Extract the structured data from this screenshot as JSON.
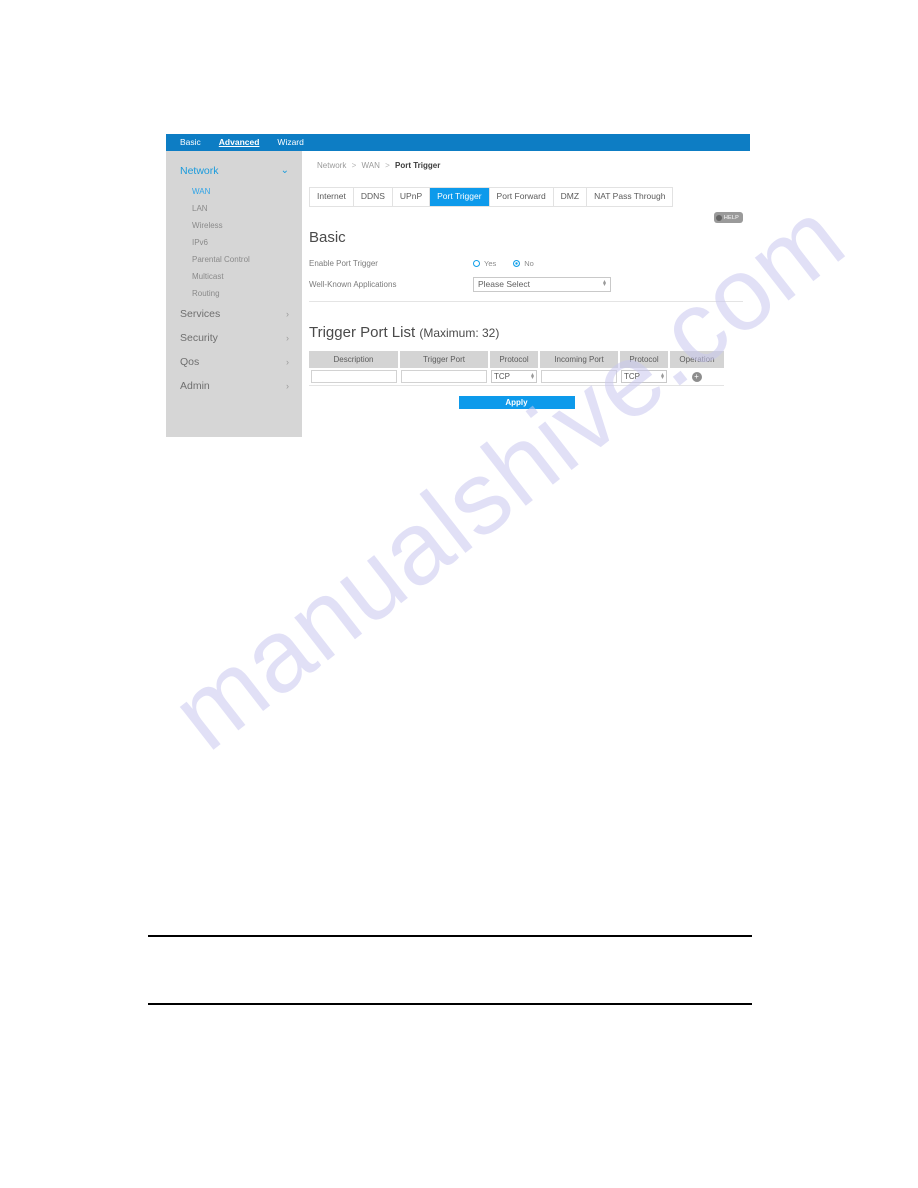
{
  "watermark": {
    "text": "manualshive.com"
  },
  "colors": {
    "topnav_blue": "#0d7dc4",
    "accent_blue": "#0d9aeb",
    "sidebar_gray": "#d6d6d6",
    "table_header_gray": "#d4d4d4",
    "watermark_lavender": "#c9c8ef"
  },
  "topnav": {
    "items": [
      {
        "label": "Basic",
        "active": false
      },
      {
        "label": "Advanced",
        "active": true
      },
      {
        "label": "Wizard",
        "active": false
      }
    ]
  },
  "sidebar": {
    "groups": [
      {
        "label": "Network",
        "active": true,
        "chevron": "chevron-down-icon",
        "chevron_glyph": "⌄"
      },
      {
        "label": "Services",
        "active": false,
        "chevron": "chevron-right-icon",
        "chevron_glyph": "›"
      },
      {
        "label": "Security",
        "active": false,
        "chevron": "chevron-right-icon",
        "chevron_glyph": "›"
      },
      {
        "label": "Qos",
        "active": false,
        "chevron": "chevron-right-icon",
        "chevron_glyph": "›"
      },
      {
        "label": "Admin",
        "active": false,
        "chevron": "chevron-right-icon",
        "chevron_glyph": "›"
      }
    ],
    "network_children": [
      {
        "label": "WAN",
        "active": true
      },
      {
        "label": "LAN",
        "active": false
      },
      {
        "label": "Wireless",
        "active": false
      },
      {
        "label": "IPv6",
        "active": false
      },
      {
        "label": "Parental Control",
        "active": false
      },
      {
        "label": "Multicast",
        "active": false
      },
      {
        "label": "Routing",
        "active": false
      }
    ]
  },
  "breadcrumb": {
    "level1": "Network",
    "level2": "WAN",
    "current": "Port Trigger",
    "separator": ">"
  },
  "tabs": [
    {
      "label": "Internet",
      "active": false
    },
    {
      "label": "DDNS",
      "active": false
    },
    {
      "label": "UPnP",
      "active": false
    },
    {
      "label": "Port Trigger",
      "active": true
    },
    {
      "label": "Port Forward",
      "active": false
    },
    {
      "label": "DMZ",
      "active": false
    },
    {
      "label": "NAT Pass Through",
      "active": false
    }
  ],
  "help": {
    "label": "HELP",
    "icon": "help-circle-icon"
  },
  "basic": {
    "title": "Basic",
    "enable_label": "Enable Port Trigger",
    "radio_yes": "Yes",
    "radio_no": "No",
    "selected": "No",
    "apps_label": "Well-Known Applications",
    "apps_value": "Please Select"
  },
  "trigger_list": {
    "title": "Trigger Port List",
    "subtitle": "(Maximum: 32)",
    "maximum": 32,
    "columns": [
      "Description",
      "Trigger Port",
      "Protocol",
      "Incoming Port",
      "Protocol",
      "Operation"
    ],
    "row": {
      "description": "",
      "trigger_port": "",
      "protocol_1": "TCP",
      "incoming_port": "",
      "protocol_2": "TCP",
      "add_icon": "add-circle-icon",
      "add_glyph": "➕"
    }
  },
  "apply": {
    "label": "Apply"
  }
}
